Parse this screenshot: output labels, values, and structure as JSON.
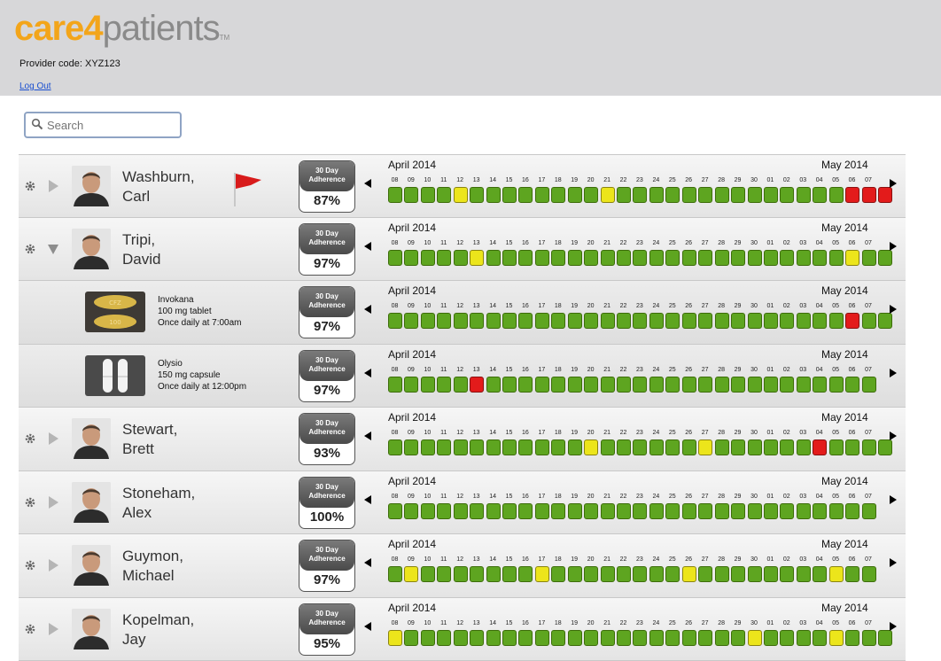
{
  "header": {
    "logo": {
      "care": "care",
      "four": "4",
      "patients": "patients",
      "tm": "TM"
    },
    "provider_code": "Provider code: XYZ123",
    "logout_label": "Log Out"
  },
  "search": {
    "placeholder": "Search",
    "value": ""
  },
  "colors": {
    "green": "#5ea520",
    "yellow": "#ece51b",
    "red": "#e31b1b",
    "brand": "#f3a51a"
  },
  "timeline": {
    "month_start": "April 2014",
    "month_end": "May 2014",
    "days": [
      "08",
      "09",
      "10",
      "11",
      "12",
      "13",
      "14",
      "15",
      "16",
      "17",
      "18",
      "19",
      "20",
      "21",
      "22",
      "23",
      "24",
      "25",
      "26",
      "27",
      "28",
      "29",
      "30",
      "01",
      "02",
      "03",
      "04",
      "05",
      "06",
      "07"
    ]
  },
  "rows": [
    {
      "kind": "patient",
      "first": "Carl",
      "last": "Washburn,",
      "expanded": false,
      "flagged": true,
      "adherence_label": "30 Day Adherence",
      "adherence": "87%",
      "cells": "ggggyggggggggyggggggggggggggrrr"
    },
    {
      "kind": "patient",
      "first": "David",
      "last": "Tripi,",
      "expanded": true,
      "flagged": false,
      "adherence_label": "30 Day Adherence",
      "adherence": "97%",
      "cells": "gggggyggggggggggggggggggggggygg"
    },
    {
      "kind": "medication",
      "med_name": "Invokana",
      "med_dose": "100 mg tablet",
      "med_schedule": "Once daily at 7:00am",
      "pill_icon": "tablet-icon",
      "adherence_label": "30 Day Adherence",
      "adherence": "97%",
      "cells": "ggggggggggggggggggggggggggggrgg"
    },
    {
      "kind": "medication",
      "med_name": "Olysio",
      "med_dose": "150 mg capsule",
      "med_schedule": "Once daily at 12:00pm",
      "pill_icon": "capsule-icon",
      "adherence_label": "30 Day Adherence",
      "adherence": "97%",
      "cells": "gggggrgggggggggggggggggggggggg"
    },
    {
      "kind": "patient",
      "first": "Brett",
      "last": "Stewart,",
      "expanded": false,
      "flagged": false,
      "adherence_label": "30 Day Adherence",
      "adherence": "93%",
      "cells": "ggggggggggggyggggggyggggggrgggg"
    },
    {
      "kind": "patient",
      "first": "Alex",
      "last": "Stoneham,",
      "expanded": false,
      "flagged": false,
      "adherence_label": "30 Day Adherence",
      "adherence": "100%",
      "cells": "gggggggggggggggggggggggggggggg"
    },
    {
      "kind": "patient",
      "first": "Michael",
      "last": "Guymon,",
      "expanded": false,
      "flagged": false,
      "adherence_label": "30 Day Adherence",
      "adherence": "97%",
      "cells": "gygggggggyggggggggyggggggggygg"
    },
    {
      "kind": "patient",
      "first": "Jay",
      "last": "Kopelman,",
      "expanded": false,
      "flagged": false,
      "adherence_label": "30 Day Adherence",
      "adherence": "95%",
      "cells": "ygggggggggggggggggggggyggggyggg"
    }
  ]
}
